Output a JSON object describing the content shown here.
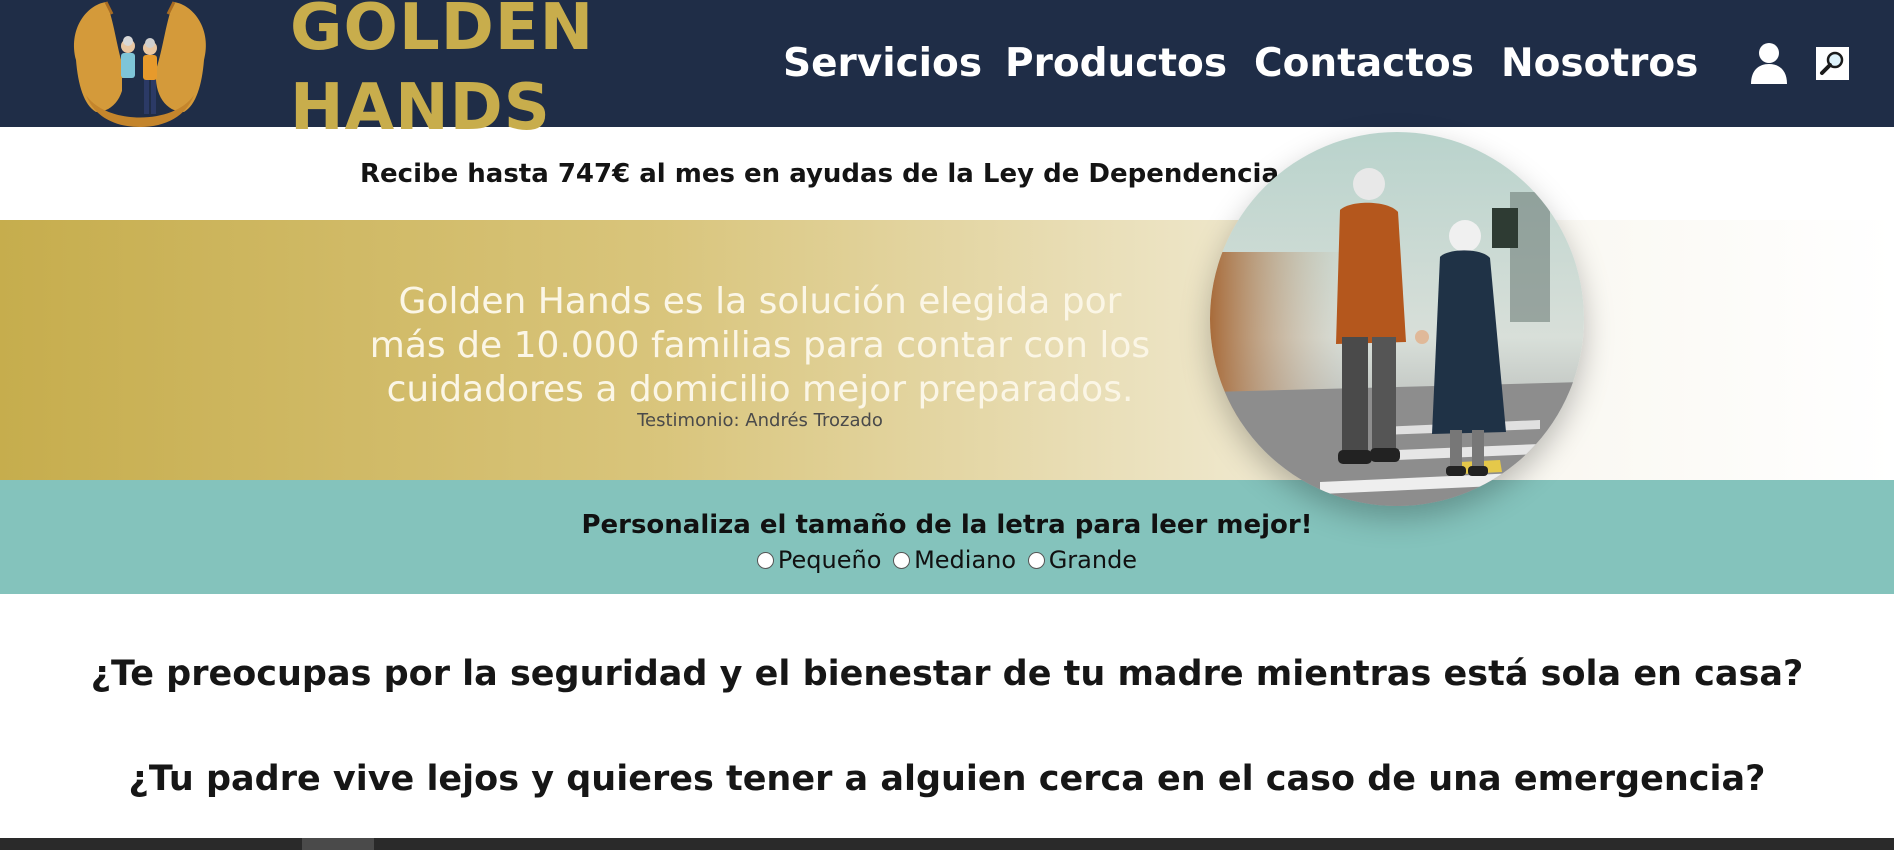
{
  "brand": {
    "line1": "GOLDEN",
    "line2": "HANDS"
  },
  "nav": {
    "items": [
      {
        "label": "Servicios"
      },
      {
        "label": "Productos"
      },
      {
        "label": "Contactos"
      },
      {
        "label": "Nosotros"
      }
    ]
  },
  "promo": {
    "text": "Recibe hasta 747€ al mes en ayudas de la Ley de Dependencia."
  },
  "hero": {
    "quote_lines": [
      "Golden Hands es la solución elegida por",
      "más de 10.000 familias para contar con los",
      "cuidadores a domicilio mejor preparados."
    ],
    "attribution": "Testimonio: Andrés Trozado"
  },
  "font_size": {
    "title": "Personaliza el tamaño de la letra para leer mejor!",
    "options": [
      {
        "label": "Pequeño"
      },
      {
        "label": "Mediano"
      },
      {
        "label": "Grande"
      }
    ]
  },
  "questions": [
    "¿Te preocupas por la seguridad y el bienestar de tu madre mientras está sola en casa?",
    "¿Tu padre vive lejos y quieres tener a alguien cerca en el caso de una emergencia?"
  ],
  "icons": {
    "logo": "hands-elderly-couple-logo",
    "user": "user-icon",
    "search": "search-icon"
  },
  "colors": {
    "header_bg": "#1f2d47",
    "brand_gold": "#c8ad4c",
    "teal_band": "#84c3bc"
  }
}
